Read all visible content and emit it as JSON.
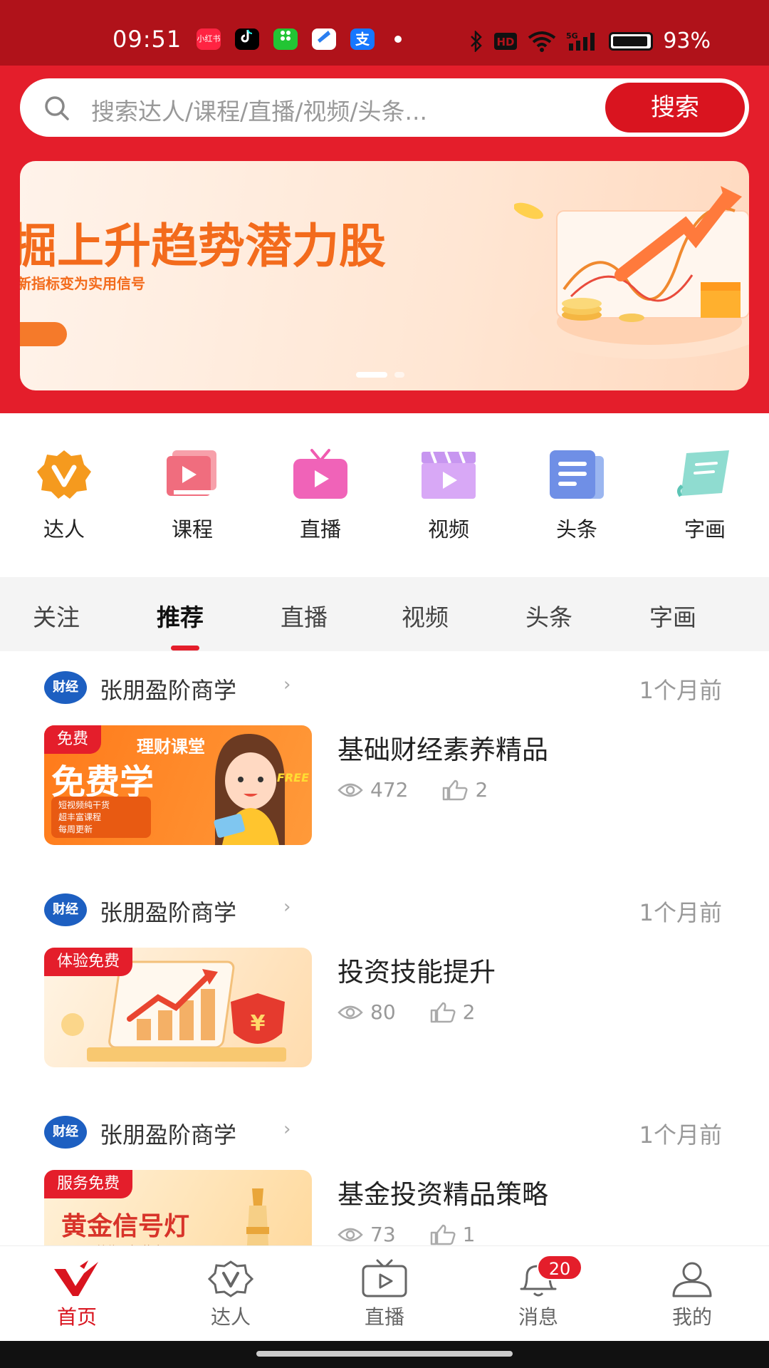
{
  "status_bar": {
    "time": "09:51",
    "apps": [
      "小红书",
      "抖音",
      "微信",
      "浏览器",
      "支付宝"
    ],
    "battery": "93%",
    "hd": "HD",
    "net": "5G"
  },
  "search": {
    "placeholder": "搜索达人/课程/直播/视频/头条...",
    "button": "搜索"
  },
  "banner": {
    "title": "掘上升趋势潜力股",
    "subtitle": "新指标变为实用信号"
  },
  "categories": [
    {
      "label": "达人",
      "icon": "badge-v-icon"
    },
    {
      "label": "课程",
      "icon": "course-icon"
    },
    {
      "label": "直播",
      "icon": "live-tv-icon"
    },
    {
      "label": "视频",
      "icon": "video-clapper-icon"
    },
    {
      "label": "头条",
      "icon": "news-icon"
    },
    {
      "label": "字画",
      "icon": "scroll-icon"
    }
  ],
  "tabs": [
    "关注",
    "推荐",
    "直播",
    "视频",
    "头条",
    "字画"
  ],
  "active_tab": "推荐",
  "feed": [
    {
      "author": "张朋盈阶商学",
      "logo_text": "财经",
      "time": "1个月前",
      "title": "基础财经素养精品",
      "views": "472",
      "likes": "2",
      "badge": "免费",
      "thumb_text": {
        "top": "理财课堂",
        "main": "免费学",
        "lines": [
          "短视频纯干货",
          "超丰富课程",
          "每周更新"
        ],
        "tag": "FREE"
      }
    },
    {
      "author": "张朋盈阶商学",
      "logo_text": "财经",
      "time": "1个月前",
      "title": "投资技能提升",
      "views": "80",
      "likes": "2",
      "badge": "体验免费",
      "thumb_text": {
        "symbol": "¥"
      }
    },
    {
      "author": "张朋盈阶商学",
      "logo_text": "财经",
      "time": "1个月前",
      "title": "基金投资精品策略",
      "views": "73",
      "likes": "1",
      "badge": "服务免费",
      "thumb_text": {
        "main": "黄金信号灯",
        "sub": "一跟着信号投黄金"
      }
    }
  ],
  "bottom_nav": [
    {
      "label": "首页",
      "icon": "home-logo-icon",
      "active": true
    },
    {
      "label": "达人",
      "icon": "badge-v-outline-icon",
      "active": false
    },
    {
      "label": "直播",
      "icon": "tv-play-icon",
      "active": false
    },
    {
      "label": "消息",
      "icon": "bell-icon",
      "active": false,
      "badge": "20"
    },
    {
      "label": "我的",
      "icon": "user-icon",
      "active": false
    }
  ],
  "colors": {
    "brand_red": "#e41e2b",
    "dark_red": "#b0121a",
    "orange": "#f36b1c"
  }
}
